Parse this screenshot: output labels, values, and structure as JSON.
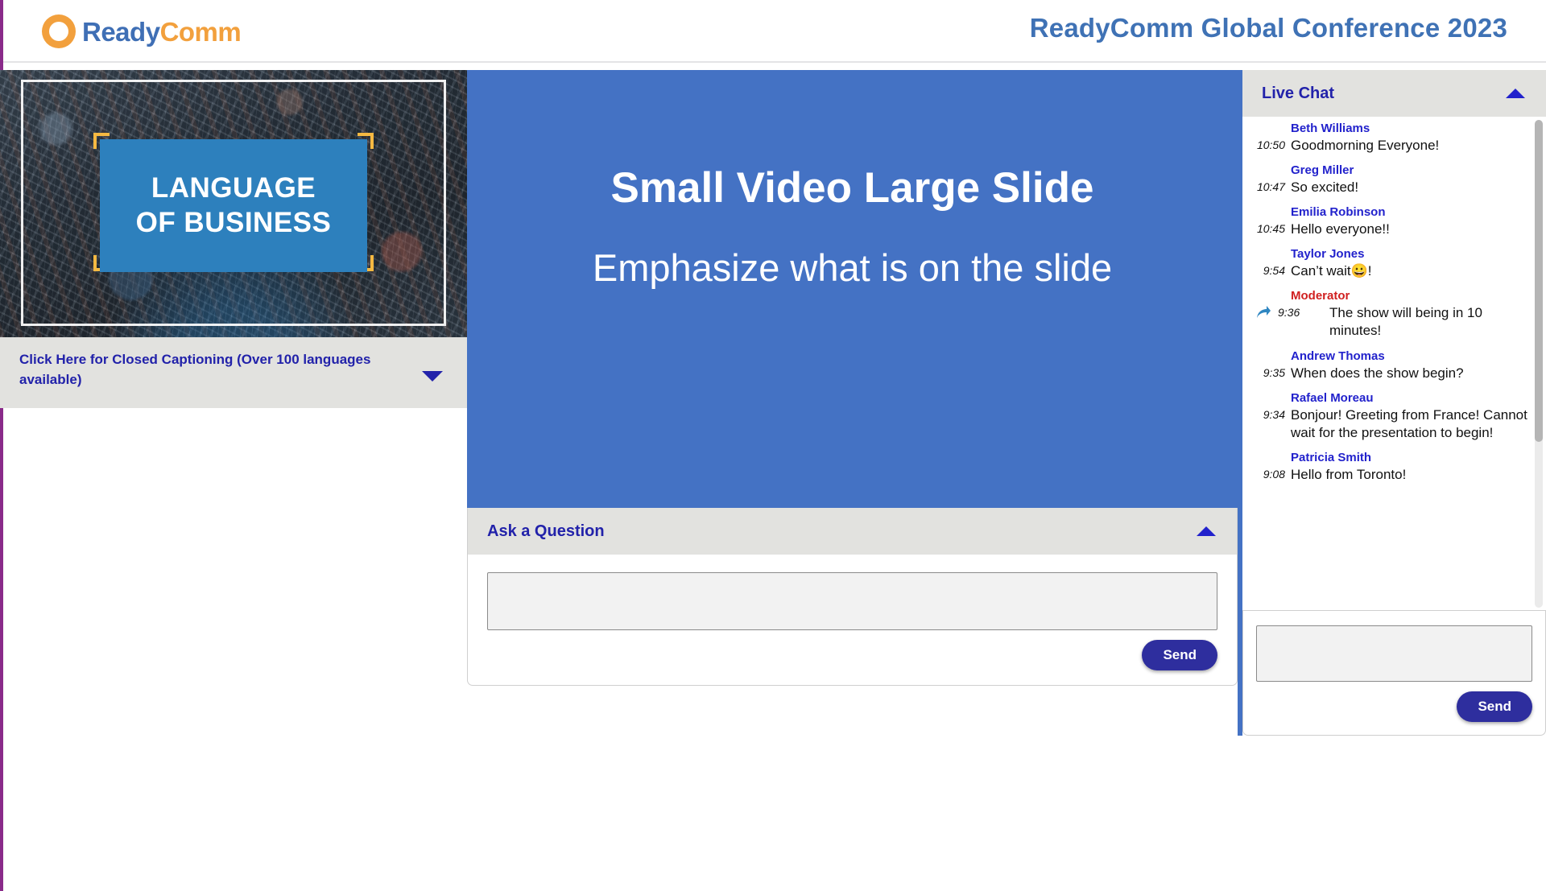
{
  "header": {
    "logo": {
      "icon": "arrow-circle-icon",
      "text_primary": "Ready",
      "text_secondary": "Comm"
    },
    "conference_title": "ReadyComm Global Conference 2023"
  },
  "video": {
    "caption_line1": "LANGUAGE",
    "caption_line2": "OF BUSINESS",
    "closed_captioning": {
      "label": "Click Here for Closed Captioning (Over 100 languages available)",
      "toggle_icon": "chevron-down-icon"
    }
  },
  "slide": {
    "title": "Small Video Large Slide",
    "subtitle": "Emphasize what is on the slide",
    "background_color": "#4472c4"
  },
  "ask_question": {
    "header_label": "Ask a Question",
    "collapse_icon": "chevron-up-icon",
    "input_value": "",
    "input_placeholder": "",
    "send_label": "Send"
  },
  "live_chat": {
    "header_label": "Live Chat",
    "collapse_icon": "chevron-up-icon",
    "messages": [
      {
        "name": "Beth Williams",
        "time": "10:50",
        "text": "Goodmorning Everyone!",
        "role": "user"
      },
      {
        "name": "Greg Miller",
        "time": "10:47",
        "text": "So excited!",
        "role": "user"
      },
      {
        "name": "Emilia Robinson",
        "time": "10:45",
        "text": "Hello everyone!!",
        "role": "user"
      },
      {
        "name": "Taylor Jones",
        "time": "9:54",
        "text": "Can’t wait😀!",
        "role": "user"
      },
      {
        "name": "Moderator",
        "time": "9:36",
        "text": "The show will being in 10 minutes!",
        "role": "moderator",
        "icon": "reply-arrow-icon"
      },
      {
        "name": "Andrew Thomas",
        "time": "9:35",
        "text": "When does the show begin?",
        "role": "user"
      },
      {
        "name": "Rafael Moreau",
        "time": "9:34",
        "text": "Bonjour! Greeting from France! Cannot wait for the presentation to begin!",
        "role": "user"
      },
      {
        "name": "Patricia Smith",
        "time": "9:08",
        "text": "Hello from Toronto!",
        "role": "user"
      }
    ],
    "input_value": "",
    "input_placeholder": "",
    "send_label": "Send"
  },
  "colors": {
    "brand_blue": "#3f6fb5",
    "brand_orange": "#f2a03d",
    "slide_blue": "#4472c4",
    "panel_gray": "#e2e2df",
    "link_blue": "#2222aa",
    "moderator_red": "#d02020",
    "send_button": "#2e2e9e",
    "page_edge_purple": "#8a2a8a"
  }
}
